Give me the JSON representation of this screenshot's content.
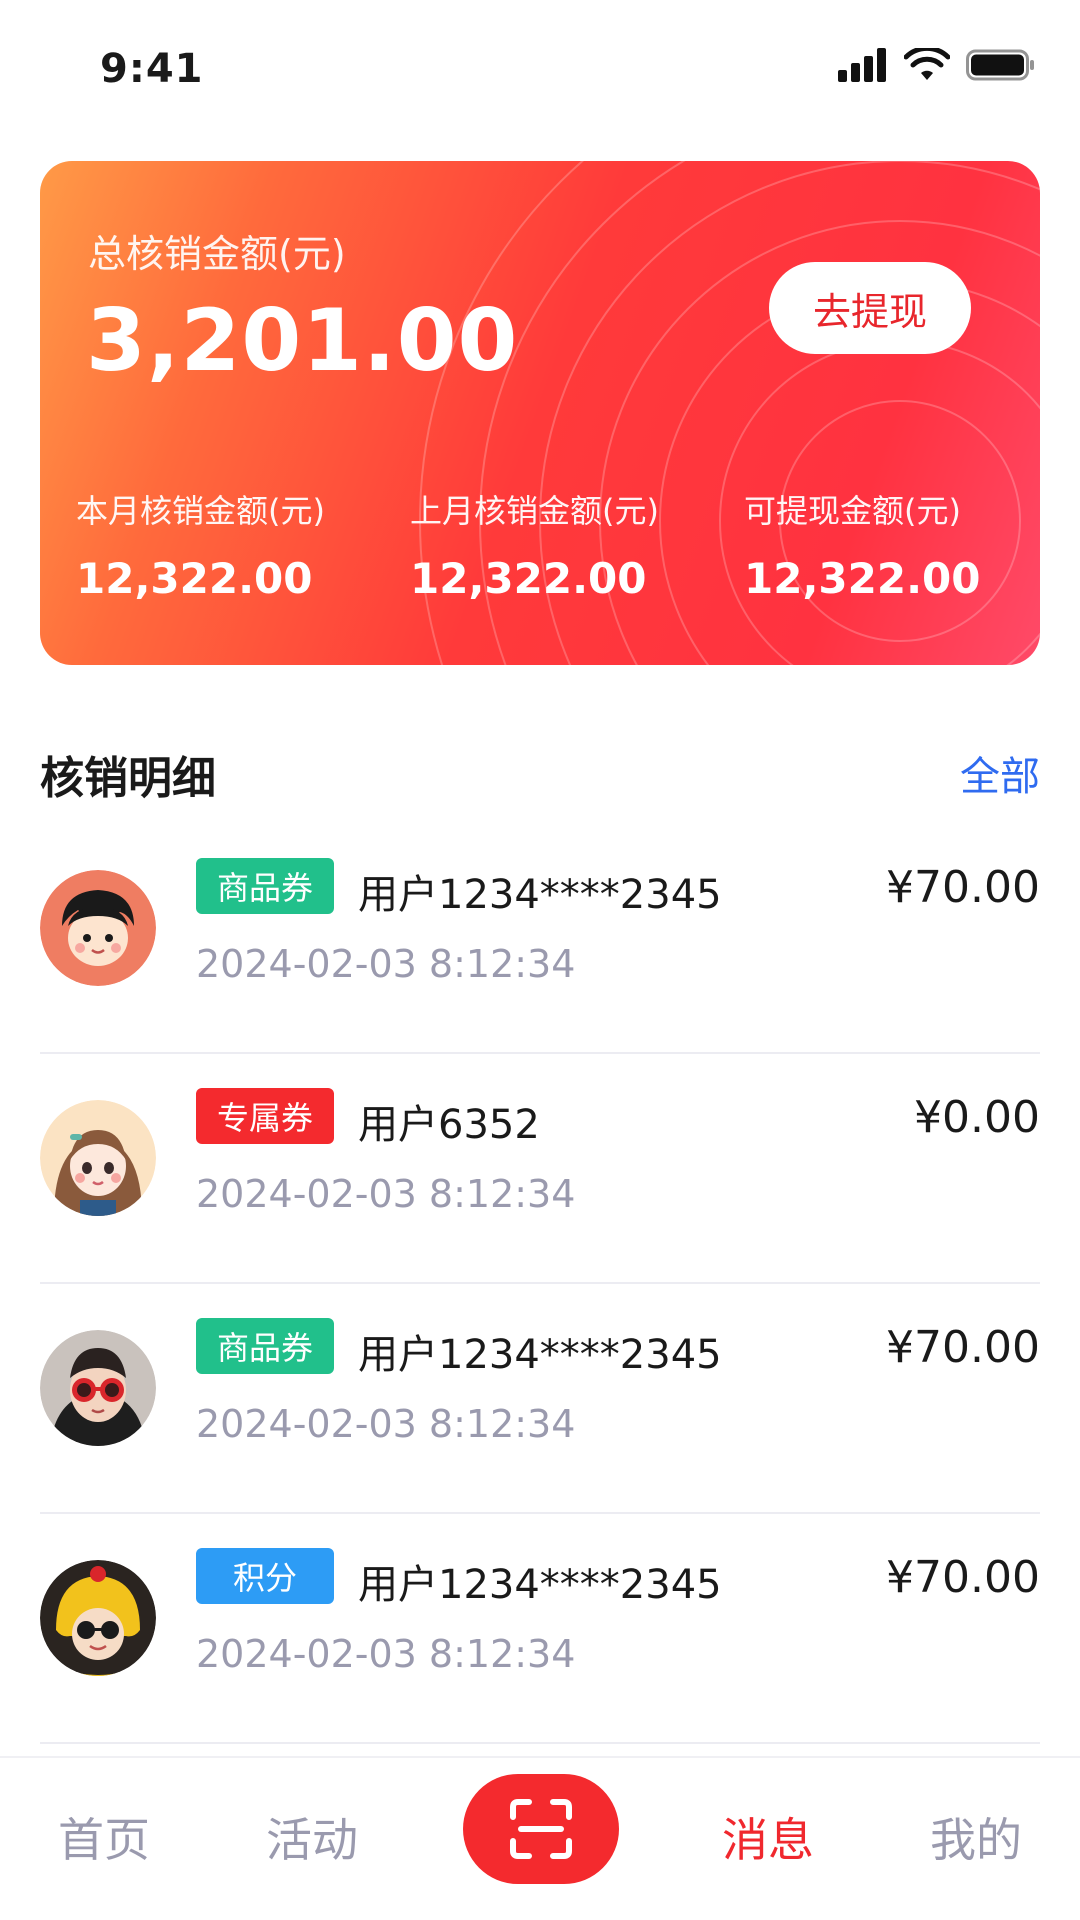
{
  "status_bar": {
    "time": "9:41"
  },
  "summary": {
    "total_label": "总核销金额(元)",
    "total_value": "3,201.00",
    "withdraw_button": "去提现",
    "stats": [
      {
        "label": "本月核销金额(元)",
        "value": "12,322.00"
      },
      {
        "label": "上月核销金额(元)",
        "value": "12,322.00"
      },
      {
        "label": "可提现金额(元)",
        "value": "12,322.00"
      }
    ]
  },
  "section": {
    "title": "核销明细",
    "link": "全部"
  },
  "records": [
    {
      "badge": "商品券",
      "badge_color": "#21c08b",
      "user": "用户1234****2345",
      "amount": "¥70.00",
      "date": "2024-02-03 8:12:34",
      "avatar": "avatar-boy-cartoon"
    },
    {
      "badge": "专属券",
      "badge_color": "#f42a2e",
      "user": "用户6352",
      "amount": "¥0.00",
      "date": "2024-02-03 8:12:34",
      "avatar": "avatar-girl-cartoon"
    },
    {
      "badge": "商品券",
      "badge_color": "#21c08b",
      "user": "用户1234****2345",
      "amount": "¥70.00",
      "date": "2024-02-03 8:12:34",
      "avatar": "avatar-child-sunglasses"
    },
    {
      "badge": "积分",
      "badge_color": "#2d9cf5",
      "user": "用户1234****2345",
      "amount": "¥70.00",
      "date": "2024-02-03 8:12:34",
      "avatar": "avatar-child-yellow-hat"
    }
  ],
  "tabbar": {
    "home": "首页",
    "activity": "活动",
    "scan_icon": "scan-icon",
    "messages": "消息",
    "mine": "我的",
    "active": "messages"
  },
  "colors": {
    "accent": "#f42a2e",
    "link": "#2f6bf0",
    "muted": "#9a9aae"
  }
}
